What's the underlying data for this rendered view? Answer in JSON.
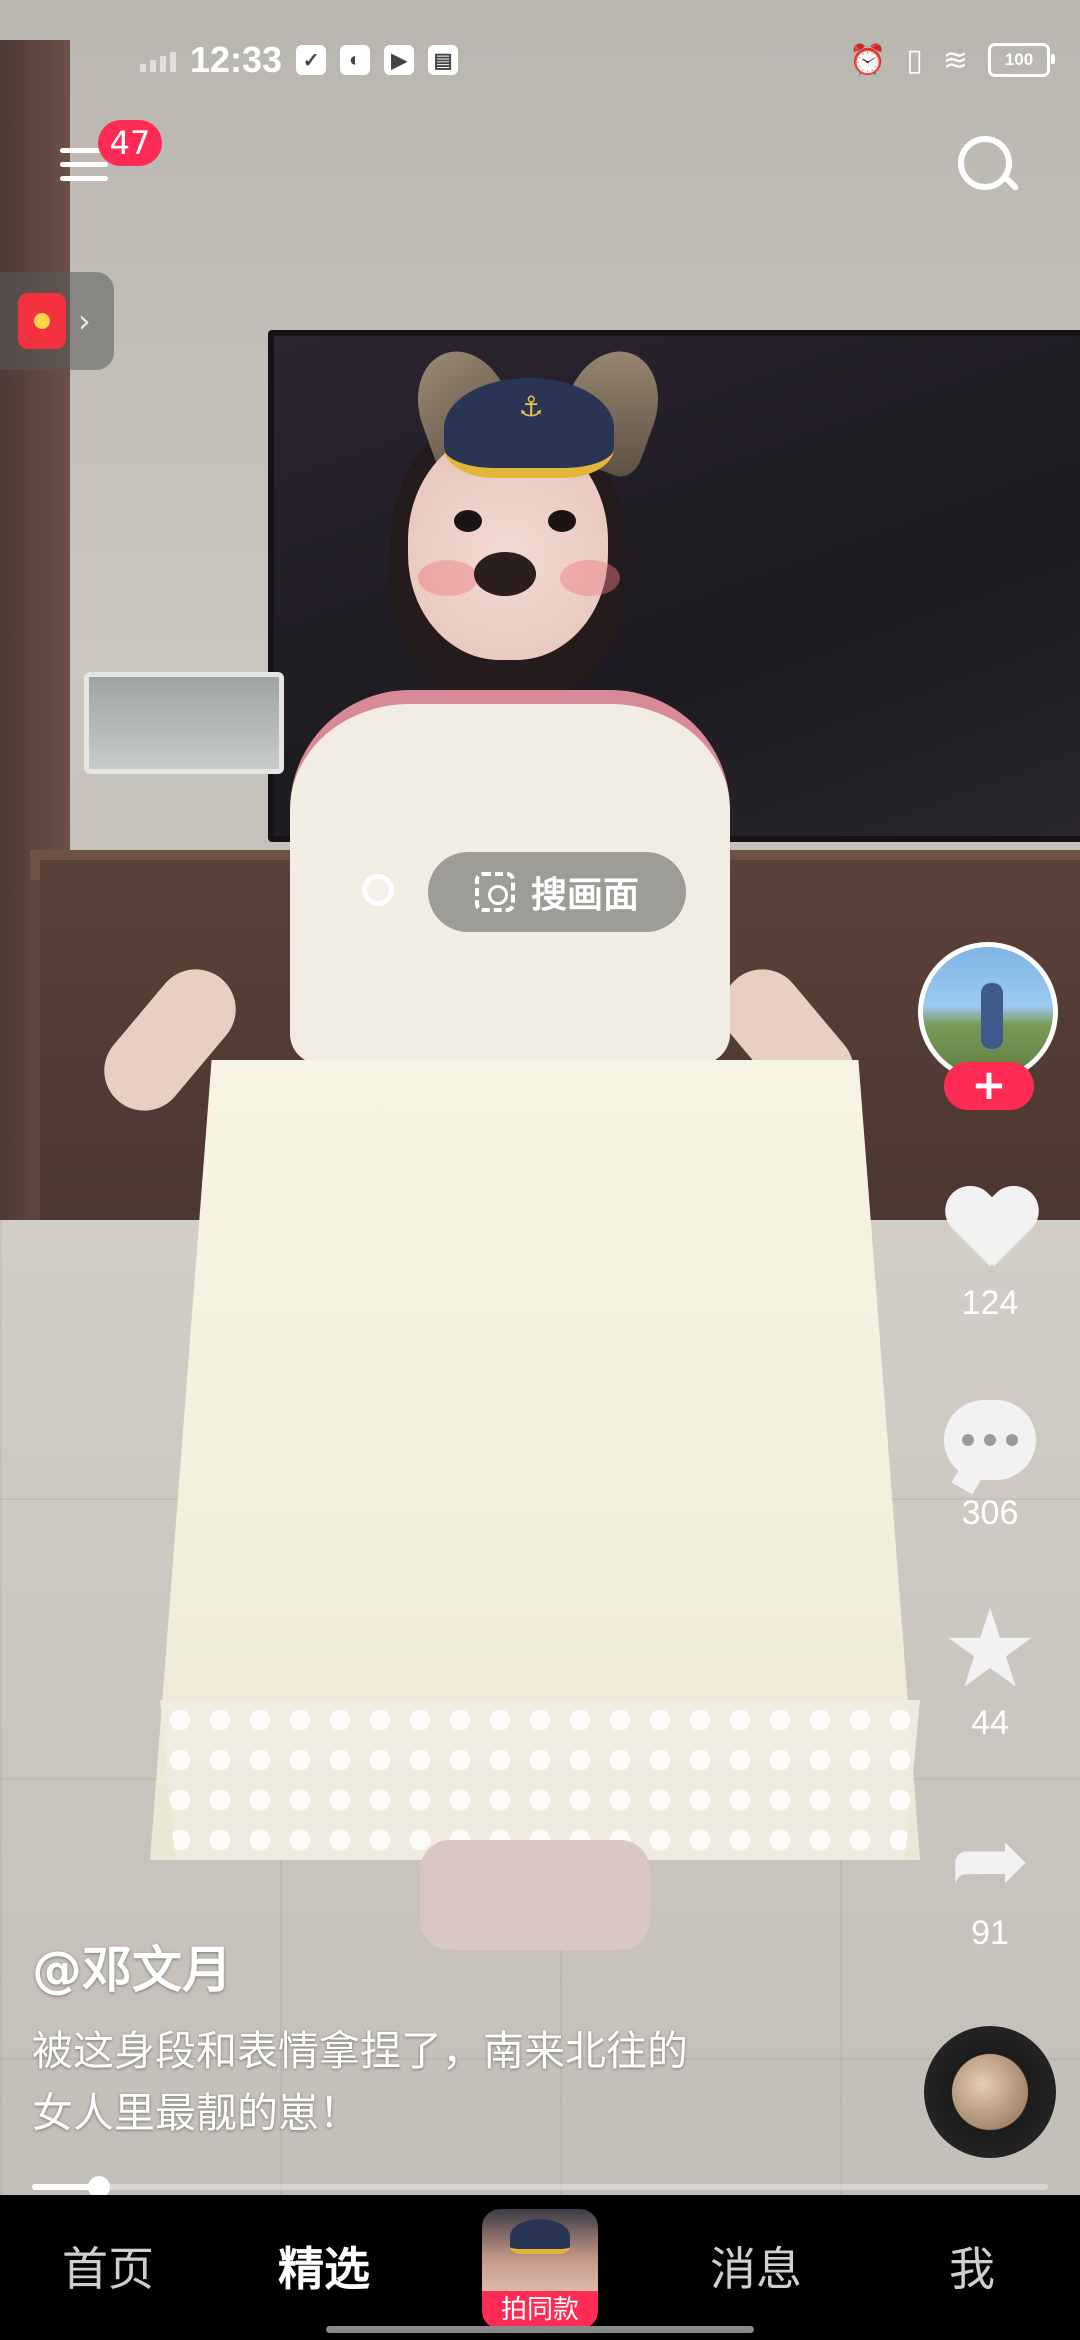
{
  "status_bar": {
    "time": "12:33",
    "battery": "100",
    "icons": [
      "signal-icon",
      "task-check-icon",
      "leaf-icon",
      "play-icon",
      "book-icon",
      "alarm-icon",
      "vibrate-icon",
      "wifi-icon",
      "battery-icon"
    ]
  },
  "top_bar": {
    "menu_badge": "47",
    "menu_icon": "hamburger-menu-icon",
    "search_icon": "search-icon",
    "red_packet_icon": "red-packet-icon",
    "red_packet_chevron": "›"
  },
  "search_screen": {
    "label": "搜画面",
    "icon": "scan-icon"
  },
  "actions": {
    "follow_label": "+",
    "likes": "124",
    "comments": "306",
    "favorites": "44",
    "shares": "91",
    "star_glyph": "★",
    "share_glyph": "➦"
  },
  "video": {
    "author": "@邓文月",
    "caption_line1": "被这身段和表情拿捏了，南来北往的",
    "caption_line2": "女人里最靓的崽！",
    "progress_fraction": 0.066
  },
  "bottom_nav": {
    "home": "首页",
    "featured": "精选",
    "shoot_label": "拍同款",
    "messages": "消息",
    "me": "我",
    "active": "featured"
  },
  "colors": {
    "accent": "#fe2c55",
    "nav_background": "#000000"
  }
}
